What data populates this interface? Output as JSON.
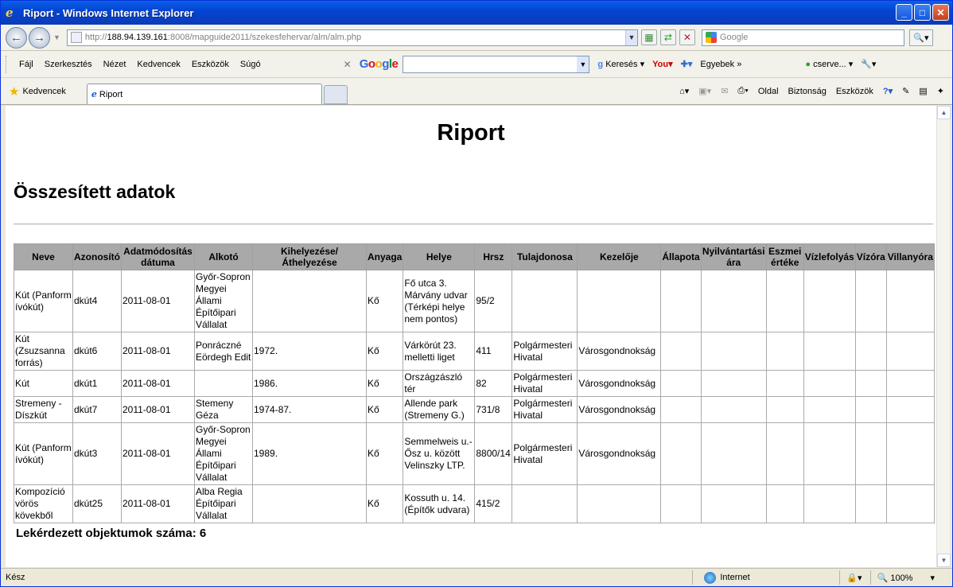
{
  "window": {
    "title": "Riport - Windows Internet Explorer"
  },
  "address": {
    "prefix": "http://",
    "host": "188.94.139.161",
    "rest": ":8008/mapguide2011/szekesfehervar/alm/alm.php"
  },
  "search": {
    "placeholder": "Google"
  },
  "menu": [
    "Fájl",
    "Szerkesztés",
    "Nézet",
    "Kedvencek",
    "Eszközök",
    "Súgó"
  ],
  "google_toolbar": {
    "search_label": "Keresés",
    "more_label": "Egyebek",
    "user_label": "cserve..."
  },
  "favorites": {
    "label": "Kedvencek"
  },
  "tab": {
    "label": "Riport"
  },
  "command_bar": [
    "Oldal",
    "Biztonság",
    "Eszközök"
  ],
  "page": {
    "title": "Riport",
    "subtitle": "Összesített adatok",
    "count_label": "Lekérdezett objektumok száma: 6"
  },
  "table": {
    "headers": [
      "Neve",
      "Azonosító",
      "Adatmódosítás dátuma",
      "Alkotó",
      "Kihelyezése/Áthelyezése",
      "Anyaga",
      "Helye",
      "Hrsz",
      "Tulajdonosa",
      "Kezelője",
      "Állapota",
      "Nyilvántartási ára",
      "Eszmei értéke",
      "Vízlefolyás",
      "Vízóra",
      "Villanyóra"
    ],
    "rows": [
      [
        "Kút (Panform ívókút)",
        "dkút4",
        "2011-08-01",
        "Győr-Sopron Megyei Állami Építőipari Vállalat",
        "",
        "Kő",
        "Fő utca 3. Márvány udvar (Térképi helye nem pontos)",
        "95/2",
        "",
        "",
        "",
        "",
        "",
        "",
        "",
        ""
      ],
      [
        "Kút (Zsuzsanna forrás)",
        "dkút6",
        "2011-08-01",
        "Ponráczné Eördegh Edit",
        "1972.",
        "Kő",
        "Várkörút 23. melletti liget",
        "411",
        "Polgármesteri Hivatal",
        "Városgondnokság",
        "",
        "",
        "",
        "",
        "",
        ""
      ],
      [
        "Kút",
        "dkút1",
        "2011-08-01",
        "",
        "1986.",
        "Kő",
        "Országzászló tér",
        "82",
        "Polgármesteri Hivatal",
        "Városgondnokság",
        "",
        "",
        "",
        "",
        "",
        ""
      ],
      [
        "Stremeny - Díszkút",
        "dkút7",
        "2011-08-01",
        "Stemeny Géza",
        "1974-87.",
        "Kő",
        "Allende park (Stremeny G.)",
        "731/8",
        "Polgármesteri Hivatal",
        "Városgondnokság",
        "",
        "",
        "",
        "",
        "",
        ""
      ],
      [
        "Kút (Panform ívókút)",
        "dkút3",
        "2011-08-01",
        "Győr-Sopron Megyei Állami Építőipari Vállalat",
        "1989.",
        "Kő",
        "Semmelweis u.-Ősz u. között Velinszky LTP.",
        "8800/14",
        "Polgármesteri Hivatal",
        "Városgondnokság",
        "",
        "",
        "",
        "",
        "",
        ""
      ],
      [
        "Kompozíció vörös kövekből",
        "dkút25",
        "2011-08-01",
        "Alba Regia Építőipari Vállalat",
        "",
        "Kő",
        "Kossuth u. 14. (Építők udvara)",
        "415/2",
        "",
        "",
        "",
        "",
        "",
        "",
        "",
        ""
      ]
    ]
  },
  "status": {
    "left": "Kész",
    "zone": "Internet",
    "zoom": "100%"
  }
}
